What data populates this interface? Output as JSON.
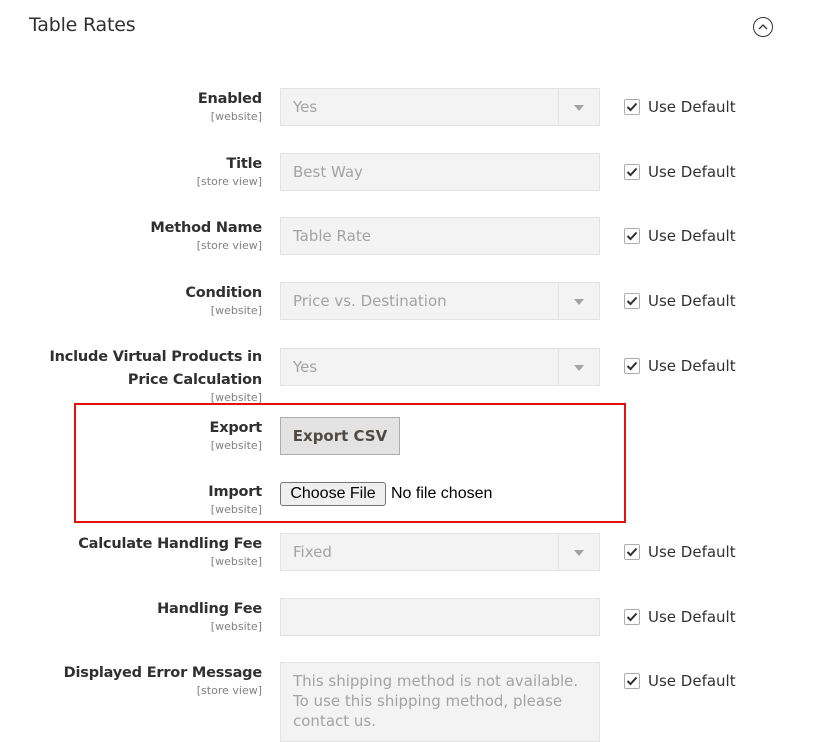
{
  "section": {
    "title": "Table Rates",
    "collapse_icon": "chevron-up-circle-icon"
  },
  "use_default_label": "Use Default",
  "fields": {
    "enabled": {
      "label": "Enabled",
      "scope": "[website]",
      "value": "Yes",
      "use_default": true
    },
    "title": {
      "label": "Title",
      "scope": "[store view]",
      "value": "Best Way",
      "use_default": true
    },
    "method_name": {
      "label": "Method Name",
      "scope": "[store view]",
      "value": "Table Rate",
      "use_default": true
    },
    "condition": {
      "label": "Condition",
      "scope": "[website]",
      "value": "Price vs. Destination",
      "use_default": true
    },
    "include_virtual": {
      "label_line1": "Include Virtual Products in",
      "label_line2": "Price Calculation",
      "scope": "[website]",
      "value": "Yes",
      "use_default": true
    },
    "export": {
      "label": "Export",
      "scope": "[website]",
      "button": "Export CSV"
    },
    "import": {
      "label": "Import",
      "scope": "[website]",
      "button": "Choose File",
      "status": "No file chosen"
    },
    "calc_handling_fee": {
      "label": "Calculate Handling Fee",
      "scope": "[website]",
      "value": "Fixed",
      "use_default": true
    },
    "handling_fee": {
      "label": "Handling Fee",
      "scope": "[website]",
      "value": "",
      "use_default": true
    },
    "error_message": {
      "label": "Displayed Error Message",
      "scope": "[store view]",
      "value": "This shipping method is not available. To use this shipping method, please contact us.",
      "use_default": true
    }
  },
  "colors": {
    "highlight_border": "#e41010",
    "field_bg": "#f3f3f3",
    "button_bg": "#e3e3e3"
  }
}
